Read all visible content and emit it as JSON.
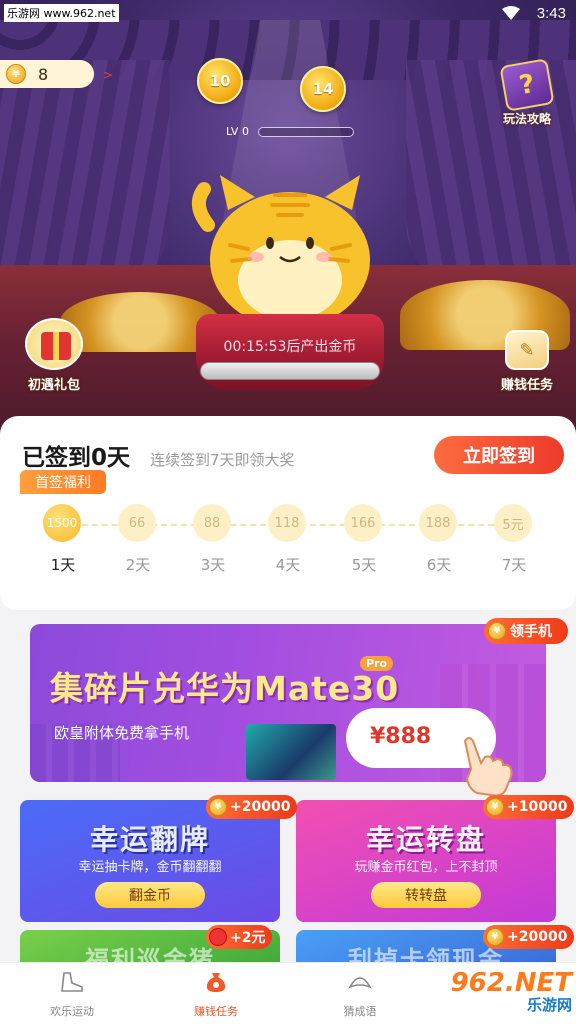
{
  "status_bar": {
    "site": "乐游网 www.962.net",
    "time": "3:43"
  },
  "balance": {
    "coins": "8",
    "arrow": ">"
  },
  "bubbles": [
    "10",
    "14"
  ],
  "guide": {
    "label": "玩法攻略"
  },
  "level": {
    "label": "LV 0",
    "progress": 0
  },
  "pedestal": {
    "timer": "00:15:53后产出金币"
  },
  "gift": {
    "label": "初遇礼包"
  },
  "task": {
    "label": "赚钱任务"
  },
  "signin": {
    "title": "已签到0天",
    "subtitle": "连续签到7天即领大奖",
    "button": "立即签到",
    "tag": "首签福利",
    "days": [
      {
        "reward": "1500",
        "label": "1天"
      },
      {
        "reward": "66",
        "label": "2天"
      },
      {
        "reward": "88",
        "label": "3天"
      },
      {
        "reward": "118",
        "label": "4天"
      },
      {
        "reward": "166",
        "label": "5天"
      },
      {
        "reward": "188",
        "label": "6天"
      },
      {
        "reward": "5元",
        "label": "7天"
      }
    ]
  },
  "banner": {
    "title": "集碎片兑华为Mate30",
    "pro": "Pro",
    "subtitle": "欧皇附体免费拿手机",
    "price": "¥888",
    "tag": "领手机"
  },
  "tiles": [
    {
      "name": "幸运翻牌",
      "desc": "幸运抽卡牌，金币翻翻翻",
      "button": "翻金币",
      "reward": "+20000"
    },
    {
      "name": "幸运转盘",
      "desc": "玩赚金币红包，上不封顶",
      "button": "转转盘",
      "reward": "+10000"
    },
    {
      "name": "福利巡金猪",
      "reward": "+2元"
    },
    {
      "name": "刮掉卡领现金",
      "reward": "+20000"
    }
  ],
  "coin_symbol": "¥",
  "nav": [
    {
      "label": "欢乐运动",
      "icon": "shoe-icon",
      "active": false
    },
    {
      "label": "赚钱任务",
      "icon": "money-bag-icon",
      "active": true
    },
    {
      "label": "猜成语",
      "icon": "fan-idiom-icon",
      "active": false
    }
  ],
  "watermark": {
    "main": "962.NET",
    "sub": "乐游网"
  },
  "colors": {
    "accent": "#ee3a2a",
    "gold": "#f5b928",
    "purple": "#8c4ad9"
  }
}
